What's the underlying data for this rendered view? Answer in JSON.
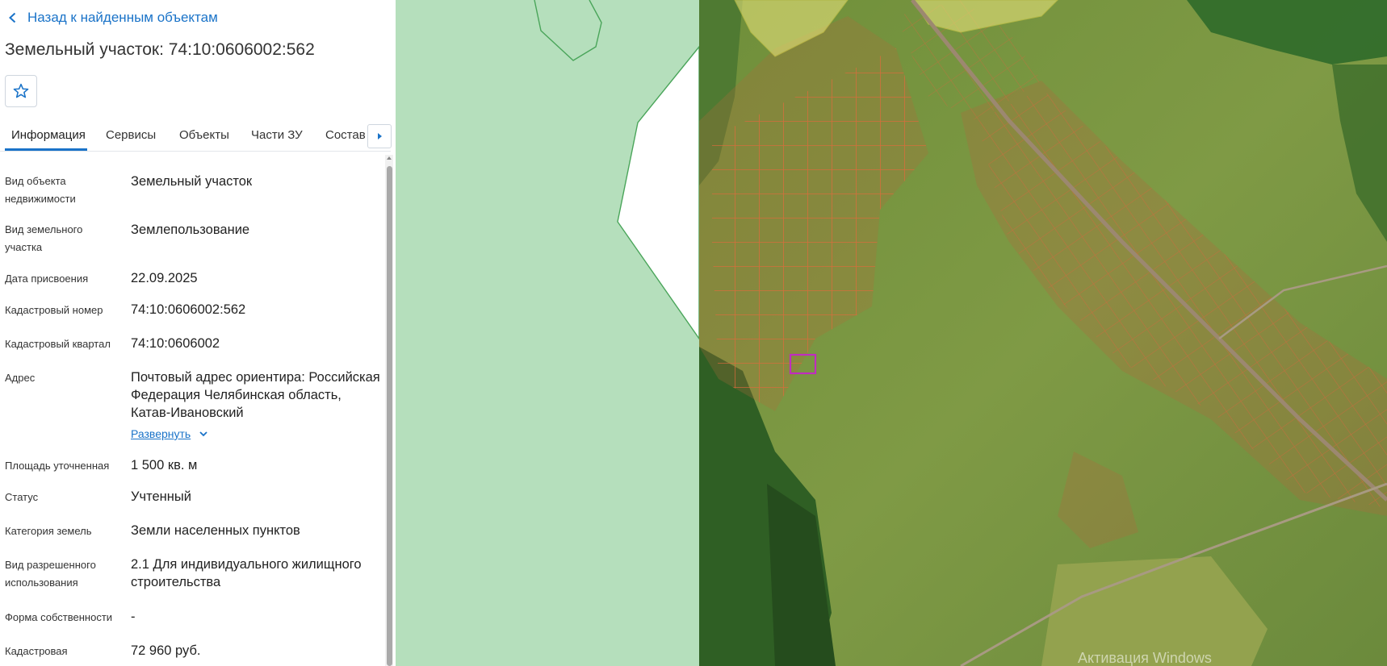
{
  "panel": {
    "back_label": "Назад к найденным объектам",
    "title": "Земельный участок: 74:10:0606002:562",
    "tabs": [
      "Информация",
      "Сервисы",
      "Объекты",
      "Части ЗУ",
      "Состав"
    ],
    "properties": [
      {
        "label": "Вид объекта недвижимости",
        "value": "Земельный участок"
      },
      {
        "label": "Вид земельного участка",
        "value": "Землепользование"
      },
      {
        "label": "Дата присвоения",
        "value": "22.09.2025"
      },
      {
        "label": "Кадастровый номер",
        "value": "74:10:0606002:562"
      },
      {
        "label": "Кадастровый квартал",
        "value": "74:10:0606002"
      },
      {
        "label": "Адрес",
        "value": "Почтовый адрес ориентира: Российская Федерация Челябинская область, Катав-Ивановский"
      },
      {
        "label": "Площадь уточненная",
        "value": "1 500 кв. м"
      },
      {
        "label": "Статус",
        "value": "Учтенный"
      },
      {
        "label": "Категория земель",
        "value": "Земли населенных пунктов"
      },
      {
        "label": "Вид разрешенного использования",
        "value": "2.1 Для индивидуального жилищного строительства"
      },
      {
        "label": "Форма собственности",
        "value": "-"
      },
      {
        "label": "Кадастровая",
        "value": "72 960 руб."
      }
    ],
    "expand_label": "Развернуть"
  },
  "map": {
    "watermark": "Активация Windows",
    "colors": {
      "pale_green": "#b5dfbc",
      "satellite": "#6c8c3e",
      "forest": "#2e5e22",
      "parcel_line": "#e0683a",
      "selected_parcel": "#c02cc0",
      "yellow_zone": "#e6e27a"
    }
  },
  "colors": {
    "accent": "#1a73c8"
  }
}
